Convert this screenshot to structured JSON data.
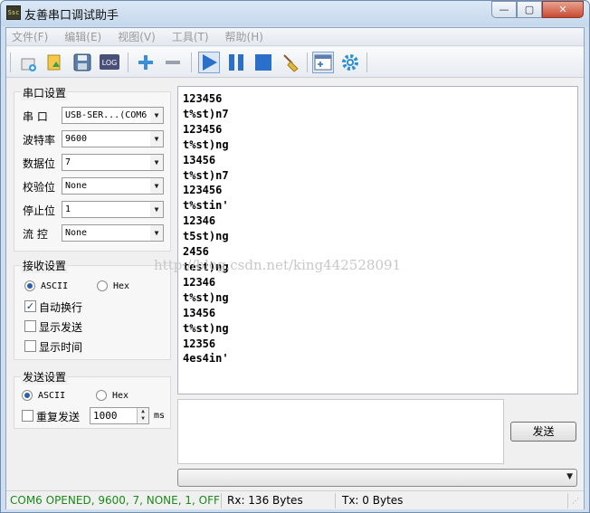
{
  "window": {
    "app_icon_text": "Ssc",
    "title": "友善串口调试助手",
    "buttons": {
      "minimize": "—",
      "maximize": "▢",
      "close": "✕"
    }
  },
  "menu": [
    "文件(F)",
    "编辑(E)",
    "视图(V)",
    "工具(T)",
    "帮助(H)"
  ],
  "toolbar": {
    "icons": [
      "new-session-icon",
      "open-icon",
      "save-icon",
      "log-icon",
      "add-icon",
      "remove-icon",
      "play-icon",
      "pause-icon",
      "stop-icon",
      "clear-broom-icon",
      "layout-icon",
      "settings-gear-icon"
    ],
    "log_text": "LOG"
  },
  "serial_settings": {
    "title": "串口设置",
    "fields": [
      {
        "label": "串  口",
        "value": "USB-SER...(COM6"
      },
      {
        "label": "波特率",
        "value": "9600"
      },
      {
        "label": "数据位",
        "value": "7"
      },
      {
        "label": "校验位",
        "value": "None"
      },
      {
        "label": "停止位",
        "value": "1"
      },
      {
        "label": "流  控",
        "value": "None"
      }
    ]
  },
  "receive_settings": {
    "title": "接收设置",
    "ascii_label": "ASCII",
    "hex_label": "Hex",
    "format_selected": "ASCII",
    "options": [
      {
        "label": "自动换行",
        "checked": true
      },
      {
        "label": "显示发送",
        "checked": false
      },
      {
        "label": "显示时间",
        "checked": false
      }
    ]
  },
  "send_settings": {
    "title": "发送设置",
    "ascii_label": "ASCII",
    "hex_label": "Hex",
    "format_selected": "ASCII",
    "repeat_label": "重复发送",
    "repeat_checked": false,
    "interval_value": "1000",
    "interval_unit": "ms"
  },
  "receive_lines": [
    "123456",
    "t%st)n7",
    "123456",
    "t%st)ng",
    "13456",
    "t%st)n7",
    "123456",
    "t%stin'",
    "12346",
    "t5st)ng",
    "2456",
    "test)ng",
    "12346",
    "t%st)ng",
    "13456",
    "t%st)ng",
    "12356",
    "4es4in'"
  ],
  "watermark": "http://blog.csdn.net/king442528091",
  "send": {
    "button_label": "发送",
    "input_value": ""
  },
  "status": {
    "port_status": "COM6 OPENED, 9600, 7, NONE, 1, OFF",
    "port_status_color": "#1a8a1a",
    "rx": "Rx: 136 Bytes",
    "tx": "Tx: 0 Bytes"
  }
}
